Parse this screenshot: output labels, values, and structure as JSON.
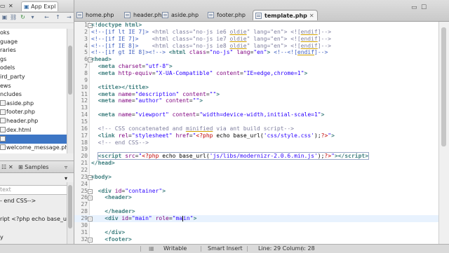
{
  "explorer": {
    "tab_label": "App Expl",
    "items": [
      "oks",
      "guage",
      "raries",
      "gs",
      "odels",
      "ird_party",
      "ews",
      "ncludes",
      "aside.php",
      "footer.php",
      "header.php",
      "dex.html",
      "",
      "welcome_message.php"
    ]
  },
  "outline": {
    "tab_label": "Samples",
    "filter_placeholder": "text",
    "items": [
      "- end CSS-->",
      "",
      "ript <?php echo base_url('j",
      "",
      "y"
    ]
  },
  "editor": {
    "tabs": [
      "home.php",
      "header.php",
      "aside.php",
      "footer.php",
      "template.php"
    ],
    "active_tab": "template.php",
    "close_glyph": "✕"
  },
  "code": {
    "current_line": 29,
    "lines": [
      {
        "n": "1",
        "fold": "−",
        "html": "<span class=\"t\">&lt;!doctype html&gt;</span>"
      },
      {
        "n": "2",
        "html": "<span class=\"c\">&lt;!--[if lt IE 7]&gt;</span> <span class=\"ct\">&lt;html class=\"no-js ie6 <span class=\"u\">oldie</span>\" lang=\"en\"&gt; &lt;![<span class=\"u\">endif</span>]--&gt;</span>"
      },
      {
        "n": "3",
        "html": "<span class=\"c\">&lt;!--[if IE 7]&gt;</span>    <span class=\"ct\">&lt;html class=\"no-js ie7 <span class=\"u\">oldie</span>\" lang=\"en\"&gt; &lt;![<span class=\"u\">endif</span>]--&gt;</span>"
      },
      {
        "n": "4",
        "html": "<span class=\"c\">&lt;!--[if IE 8]&gt;</span>    <span class=\"ct\">&lt;html class=\"no-js ie8 <span class=\"u\">oldie</span>\" lang=\"en\"&gt; &lt;![<span class=\"u\">endif</span>]--&gt;</span>"
      },
      {
        "n": "5",
        "html": "<span class=\"c\">&lt;!--[if gt IE 8]&gt;&lt;!--&gt;</span> <span class=\"t\">&lt;html</span> <span class=\"a\">class</span>=<span class=\"v\">\"no-js\"</span> <span class=\"a\">lang</span>=<span class=\"v\">\"en\"</span><span class=\"t\">&gt;</span> <span class=\"c\">&lt;!--&lt;![<span class=\"u\">endif</span>]--&gt;</span>"
      },
      {
        "n": "6",
        "fold": "−",
        "html": "<span class=\"t\">&lt;head&gt;</span>"
      },
      {
        "n": "7",
        "html": "  <span class=\"t\">&lt;meta</span> <span class=\"a\">charset</span>=<span class=\"v\">\"utf-8\"</span><span class=\"t\">&gt;</span>"
      },
      {
        "n": "8",
        "html": "  <span class=\"t\">&lt;meta</span> <span class=\"a\">http-equiv</span>=<span class=\"v\">\"X-UA-Compatible\"</span> <span class=\"a\">content</span>=<span class=\"v\">\"IE=edge,chrome=1\"</span><span class=\"t\">&gt;</span>"
      },
      {
        "n": "9",
        "html": ""
      },
      {
        "n": "10",
        "html": "  <span class=\"t\">&lt;title&gt;&lt;/title&gt;</span>"
      },
      {
        "n": "11",
        "html": "  <span class=\"t\">&lt;meta</span> <span class=\"a\">name</span>=<span class=\"v\">\"description\"</span> <span class=\"a\">content</span>=<span class=\"v\">\"\"</span><span class=\"t\">&gt;</span>"
      },
      {
        "n": "12",
        "html": "  <span class=\"t\">&lt;meta</span> <span class=\"a\">name</span>=<span class=\"v\">\"author\"</span> <span class=\"a\">content</span>=<span class=\"v\">\"\"</span><span class=\"t\">&gt;</span>"
      },
      {
        "n": "13",
        "html": ""
      },
      {
        "n": "14",
        "html": "  <span class=\"t\">&lt;meta</span> <span class=\"a\">name</span>=<span class=\"v\">\"viewport\"</span> <span class=\"a\">content</span>=<span class=\"v\">\"width=device-width,initial-scale=1\"</span><span class=\"t\">&gt;</span>"
      },
      {
        "n": "15",
        "html": ""
      },
      {
        "n": "16",
        "html": "  <span class=\"ct\">&lt;!-- CSS concatenated and <span class=\"u\">minified</span> via ant build script--&gt;</span>"
      },
      {
        "n": "17",
        "html": "  <span class=\"t\">&lt;link</span> <span class=\"a\">rel</span>=<span class=\"v\">\"stylesheet\"</span> <span class=\"a\">href</span>=<span class=\"v\">\"</span><span class=\"p\">&lt;?php</span> <span class=\"txt\">echo base_url(</span><span class=\"v\">'css/style.css'</span><span class=\"txt\">);</span><span class=\"p\">?&gt;</span><span class=\"v\">\"</span><span class=\"t\">&gt;</span>"
      },
      {
        "n": "18",
        "html": "  <span class=\"ct\">&lt;!-- end CSS--&gt;</span>"
      },
      {
        "n": "19",
        "html": ""
      },
      {
        "n": "20",
        "html": "  <span class=\"sel-box\"><span class=\"t\">&lt;script</span> <span class=\"a\">src</span>=<span class=\"v\">\"</span><span class=\"p\">&lt;?php</span> <span class=\"txt\">echo base_url(</span><span class=\"v\">'js/libs/modernizr-2.0.6.min.js'</span><span class=\"txt\">);</span><span class=\"p\">?&gt;</span><span class=\"v\">\"</span><span class=\"t\">&gt;&lt;/script&gt;</span></span>"
      },
      {
        "n": "21",
        "html": "<span class=\"t\">&lt;/head&gt;</span>"
      },
      {
        "n": "22",
        "html": ""
      },
      {
        "n": "23",
        "fold": "−",
        "html": "<span class=\"t\">&lt;body&gt;</span>"
      },
      {
        "n": "24",
        "html": ""
      },
      {
        "n": "25",
        "fold": "−",
        "html": "  <span class=\"t\">&lt;div</span> <span class=\"a\">id</span>=<span class=\"v\">\"container\"</span><span class=\"t\">&gt;</span>"
      },
      {
        "n": "26",
        "fold": "−",
        "html": "    <span class=\"t\">&lt;header&gt;</span>"
      },
      {
        "n": "27",
        "html": ""
      },
      {
        "n": "28",
        "html": "    <span class=\"t\">&lt;/header&gt;</span>"
      },
      {
        "n": "29",
        "fold": "−",
        "html": "    <span class=\"t\">&lt;div</span> <span class=\"a\">id</span>=<span class=\"v\">\"main\"</span> <span class=\"a\">role</span>=<span class=\"v\">\"ma<span class=\"caret\"></span>in\"</span><span class=\"t\">&gt;</span>"
      },
      {
        "n": "30",
        "html": ""
      },
      {
        "n": "31",
        "html": "    <span class=\"t\">&lt;/div&gt;</span>"
      },
      {
        "n": "32",
        "fold": "−",
        "html": "    <span class=\"t\">&lt;footer&gt;</span>"
      }
    ]
  },
  "status": {
    "mode": "Writable",
    "insert": "Smart Insert",
    "position": "Line: 29 Column: 28"
  }
}
